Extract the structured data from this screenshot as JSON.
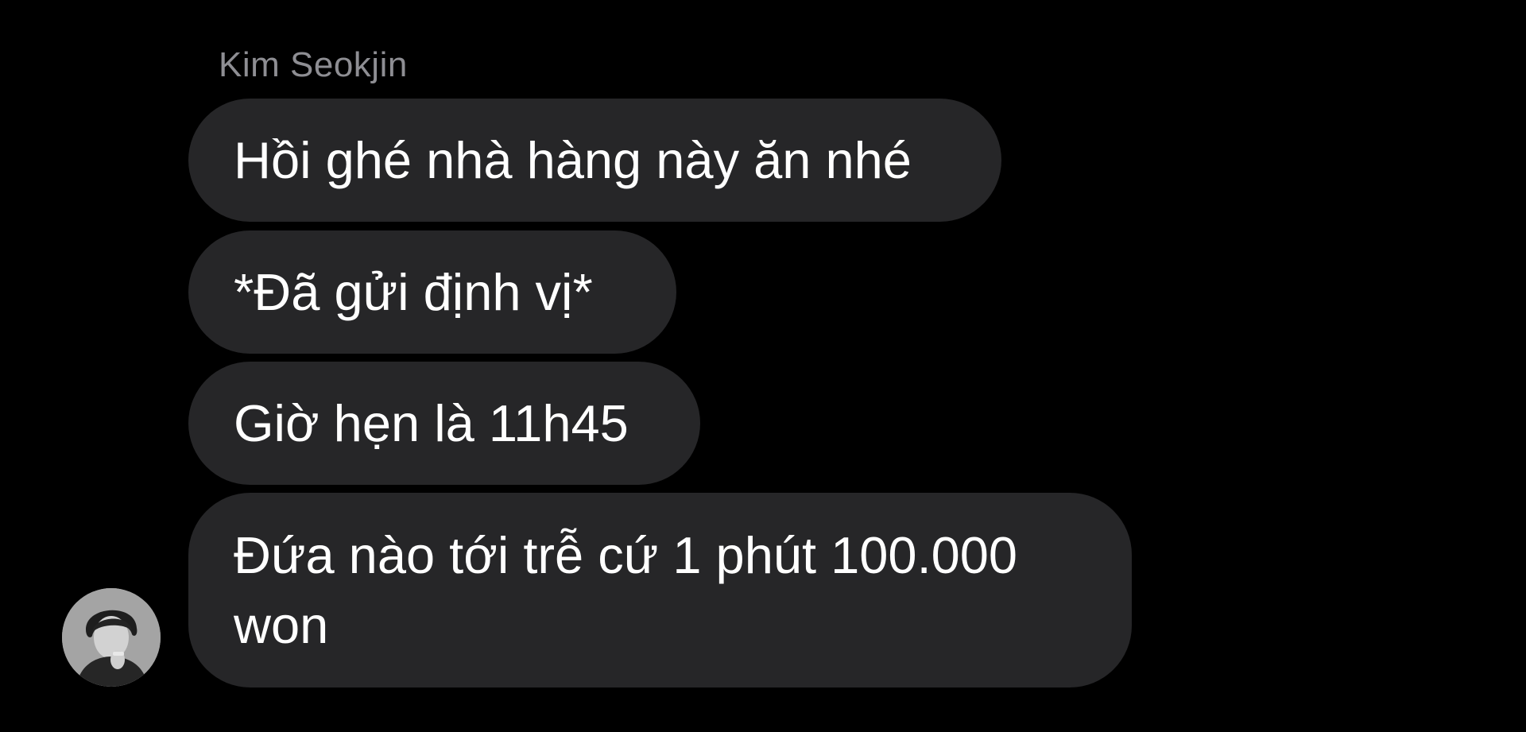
{
  "chat": {
    "sender_name": "Kim Seokjin",
    "avatar_icon": "profile-photo",
    "colors": {
      "background": "#000000",
      "bubble": "#262628",
      "bubble_text": "#ffffff",
      "sender_name": "#8e8e93"
    },
    "messages": [
      {
        "text": "Hồi ghé nhà hàng này ăn nhé"
      },
      {
        "text": "*Đã gửi định vị*"
      },
      {
        "text": "Giờ hẹn là 11h45"
      },
      {
        "text": "Đứa nào tới trễ cứ 1 phút 100.000 won"
      }
    ]
  }
}
